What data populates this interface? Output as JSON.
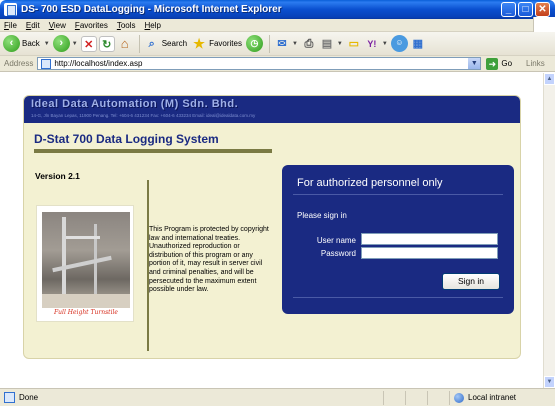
{
  "window": {
    "title": "DS- 700 ESD DataLogging - Microsoft Internet Explorer",
    "minimize": "_",
    "maximize": "□",
    "close": "✕"
  },
  "menu": [
    "File",
    "Edit",
    "View",
    "Favorites",
    "Tools",
    "Help"
  ],
  "toolbar": {
    "back_label": "Back",
    "search_label": "Search",
    "favorites_label": "Favorites",
    "icons": [
      "back-arrow",
      "forward-arrow",
      "stop",
      "refresh",
      "home",
      "search",
      "favorites-star",
      "history",
      "mail",
      "print",
      "edit",
      "folder",
      "yahoo",
      "messenger",
      "research"
    ]
  },
  "address": {
    "label": "Address",
    "url": "http://localhost/index.asp",
    "go_label": "Go",
    "links_label": "Links"
  },
  "page": {
    "company_name": "Ideal Data Automation (M) Sdn. Bhd.",
    "company_address": "14-G, Jln Bayan Lepas, 11900 Penang. Tel: +604-6 431234  Fax: +604-6 433234  Email: ideal@idealdata.com.my",
    "system_title": "D-Stat 700 Data Logging System",
    "version": "Version 2.1",
    "photo_caption": "Full Height Turnstile",
    "copyright_notice": "This Program is protected by copyright law and international treaties. Unauthorized reproduction or distribution of this program or any portion of it, may result in server civil and criminal penalties, and will be persecuted to the maximum extent possible under law."
  },
  "login": {
    "title": "For authorized personnel only",
    "subtitle": "Please sign in",
    "username_label": "User name",
    "username_value": "",
    "password_label": "Password",
    "password_value": "",
    "signin_label": "Sign in"
  },
  "status": {
    "text": "Done",
    "zone": "Local intranet"
  },
  "colors": {
    "titlebar": "#0a4fcf",
    "banner": "#1a2a82",
    "panel_bg": "#f3f1d2",
    "rule": "#7a7a44"
  }
}
